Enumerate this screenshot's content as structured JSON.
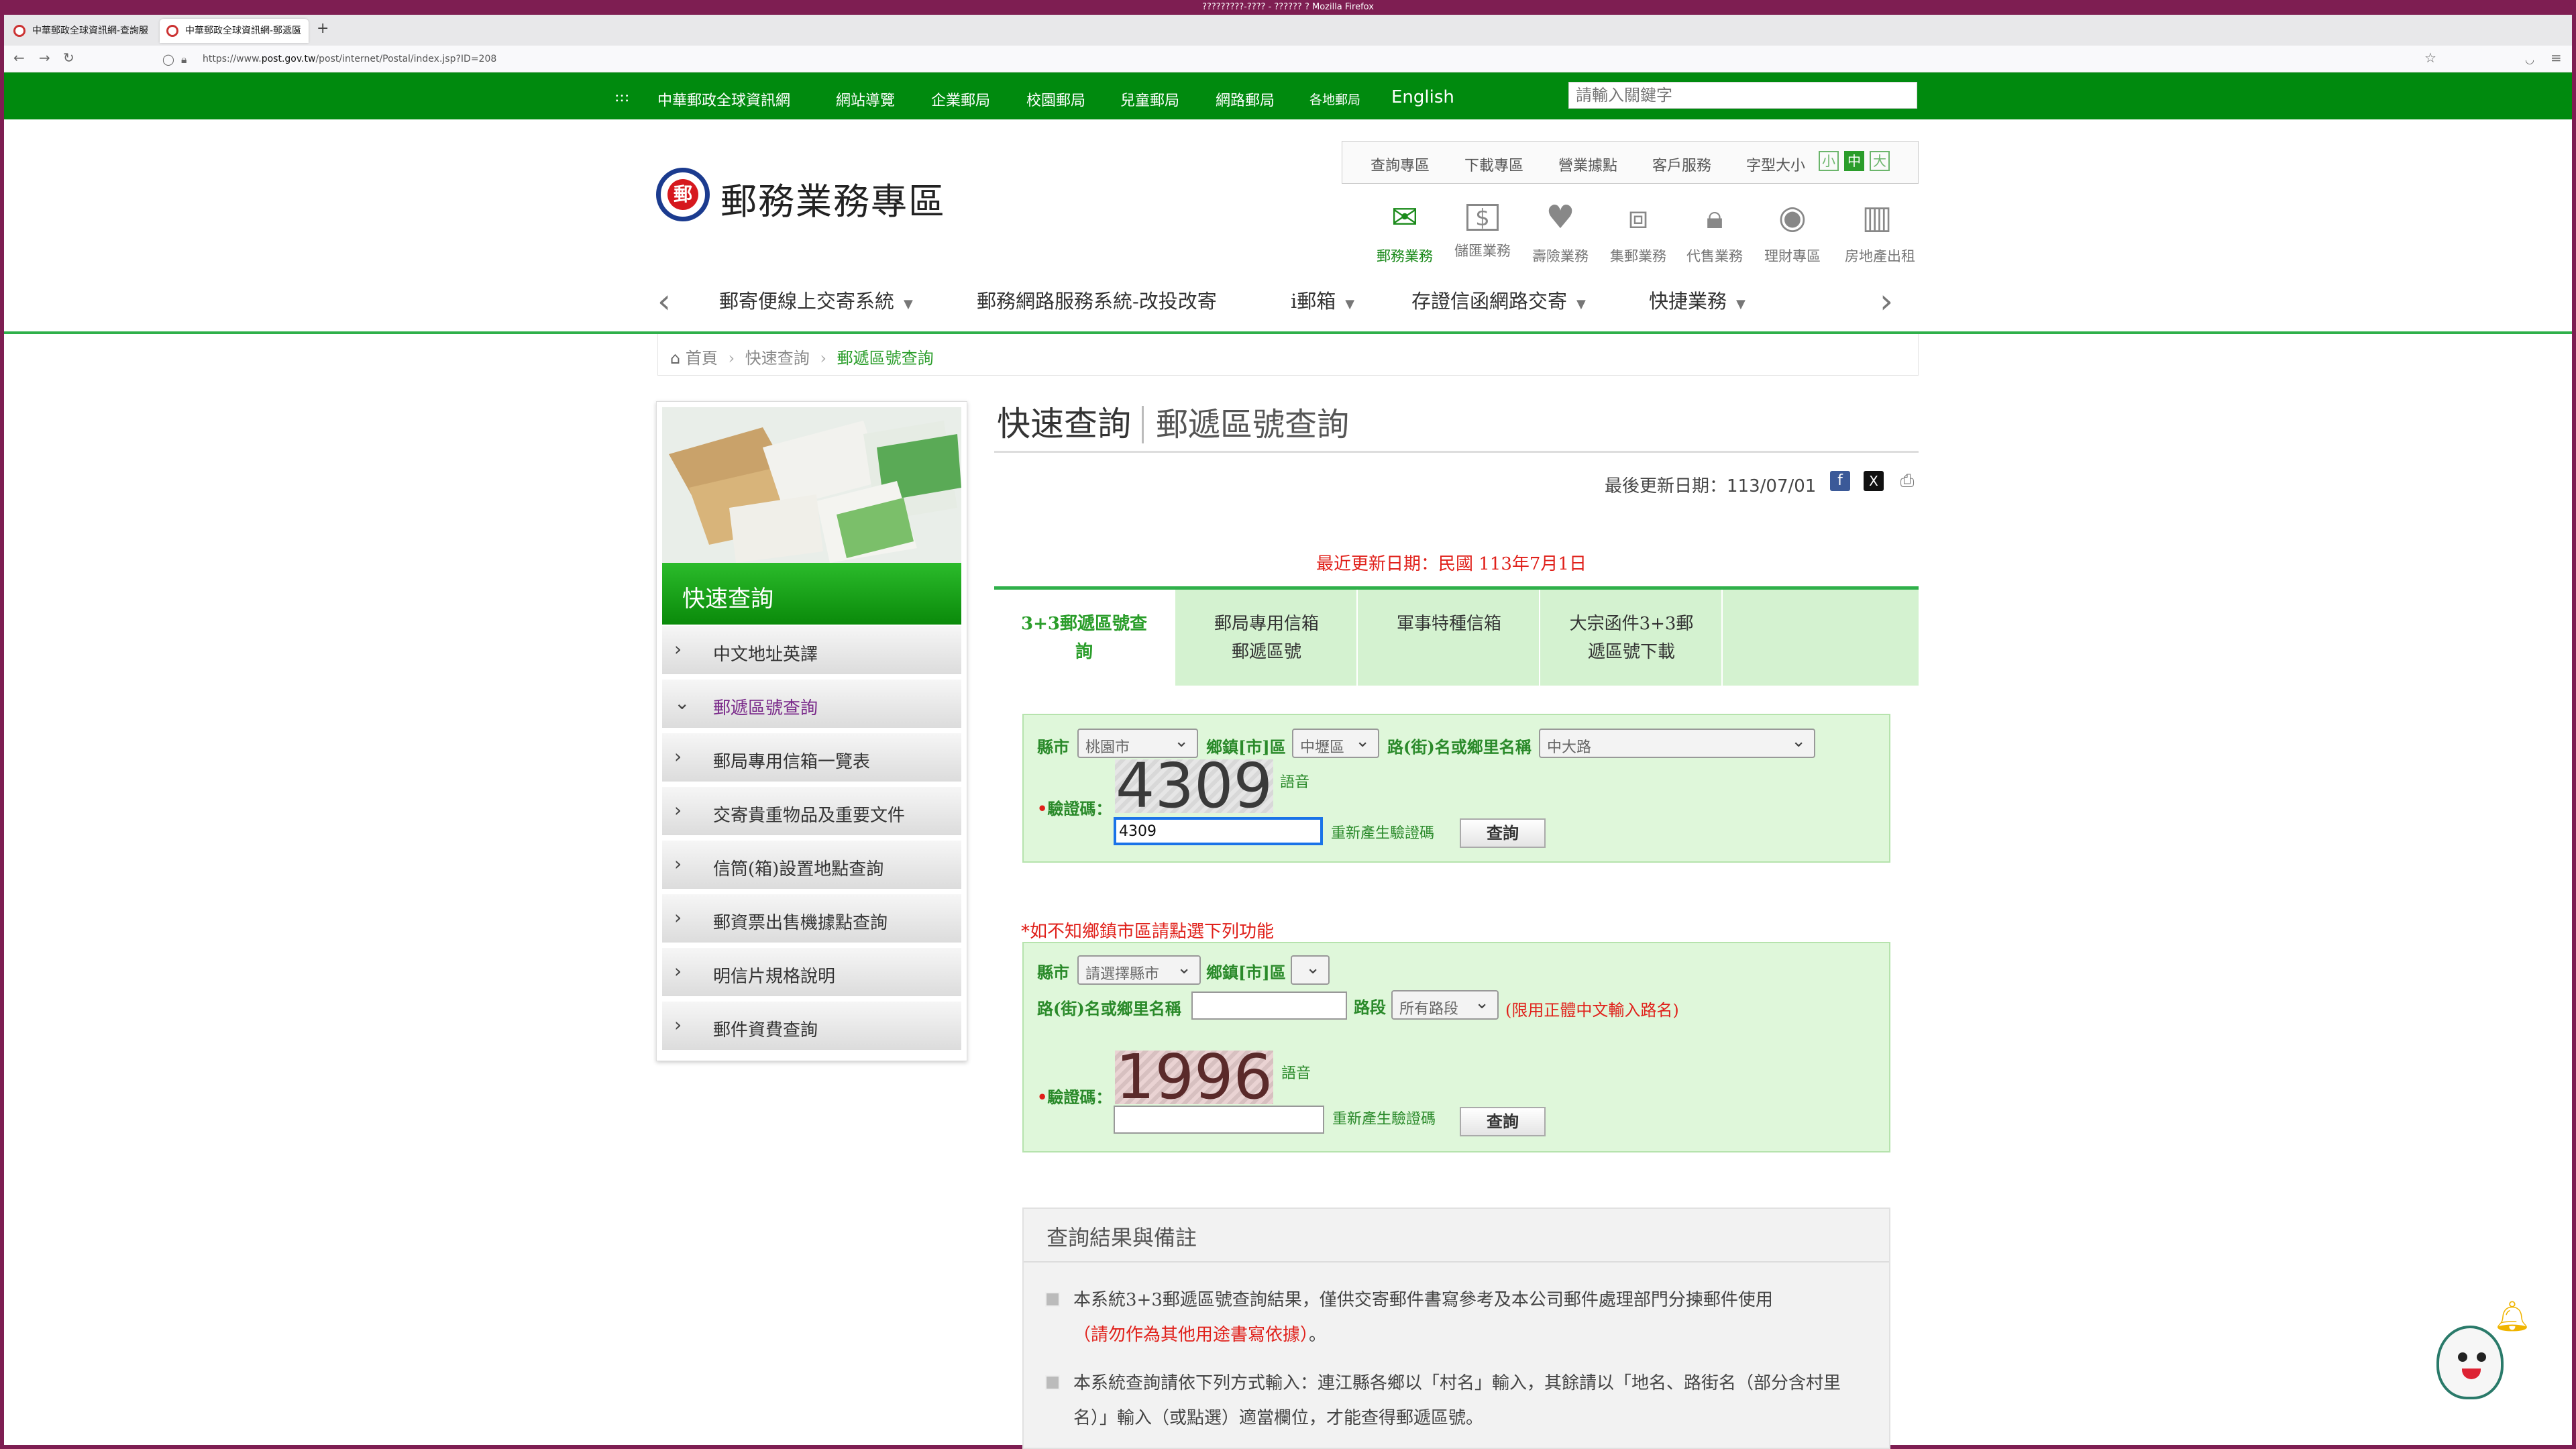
{
  "window": {
    "title": "?????????-???? - ?????? ? Mozilla Firefox"
  },
  "browser": {
    "tabs": [
      {
        "label": "中華郵政全球資訊網-查詢服"
      },
      {
        "label": "中華郵政全球資訊網-郵遞區"
      }
    ],
    "new_tab": "+",
    "url_prefix": "https://www.",
    "url_host": "post.gov.tw",
    "url_path": "/post/internet/Postal/index.jsp?ID=208"
  },
  "topnav": {
    "menu_icon": ":::",
    "items": [
      "中華郵政全球資訊網",
      "網站導覽",
      "企業郵局",
      "校園郵局",
      "兒童郵局",
      "網路郵局",
      "各地郵局",
      "English"
    ],
    "search_placeholder": "請輸入關鍵字"
  },
  "header": {
    "logo_mark": "郵",
    "logo_text": "郵務業務專區",
    "utility": [
      "查詢專區",
      "下載專區",
      "營業據點",
      "客戶服務",
      "字型大小"
    ],
    "font_sizes": [
      "小",
      "中",
      "大"
    ],
    "services": [
      {
        "icon": "mail-icon",
        "label": "郵務業務"
      },
      {
        "icon": "savings-icon",
        "label": "儲匯業務"
      },
      {
        "icon": "insurance-icon",
        "label": "壽險業務"
      },
      {
        "icon": "stamp-icon",
        "label": "集郵業務"
      },
      {
        "icon": "agency-icon",
        "label": "代售業務"
      },
      {
        "icon": "finance-icon",
        "label": "理財專區"
      },
      {
        "icon": "building-icon",
        "label": "房地產出租"
      }
    ],
    "menu": [
      "郵寄便線上交寄系統",
      "郵務網路服務系統-改投改寄",
      "i郵箱",
      "存證信函網路交寄",
      "快捷業務"
    ]
  },
  "breadcrumb": [
    "首頁",
    "快速查詢",
    "郵遞區號查詢"
  ],
  "sidebar": {
    "title": "快速查詢",
    "items": [
      "中文地址英譯",
      "郵遞區號查詢",
      "郵局專用信箱一覽表",
      "交寄貴重物品及重要文件",
      "信筒(箱)設置地點查詢",
      "郵資票出售機據點查詢",
      "明信片規格說明",
      "郵件資費查詢"
    ]
  },
  "main": {
    "title": "快速查詢",
    "subtitle": "郵遞區號查詢",
    "last_update_label": "最後更新日期：",
    "last_update": "113/07/01",
    "notice": "最近更新日期：民國 113年7月1日",
    "tabs": [
      [
        "3+3郵遞區號查",
        "詢"
      ],
      [
        "郵局專用信箱",
        "郵遞區號"
      ],
      [
        "軍事特種信箱",
        ""
      ],
      [
        "大宗函件3+3郵",
        "遞區號下載"
      ]
    ]
  },
  "form1": {
    "city_label": "縣市",
    "city_value": "桃園市",
    "district_label": "鄉鎮[市]區",
    "district_value": "中壢區",
    "road_label": "路(街)名或鄉里名稱",
    "road_value": "中大路",
    "audio": "語音",
    "captcha_label": "驗證碼：",
    "captcha_image": "4309",
    "captcha_input": "4309",
    "refresh": "重新產生驗證碼",
    "submit": "查詢"
  },
  "hint": "如不知鄉鎮市區請點選下列功能",
  "form2": {
    "city_label": "縣市",
    "city_value": "請選擇縣市",
    "district_label": "鄉鎮[市]區",
    "road_label": "路(街)名或鄉里名稱",
    "section_label": "路段",
    "section_value": "所有路段",
    "limit_note": "(限用正體中文輸入路名)",
    "audio": "語音",
    "captcha_label": "驗證碼：",
    "captcha_image": "1996",
    "refresh": "重新產生驗證碼",
    "submit": "查詢"
  },
  "results": {
    "title": "查詢結果與備註",
    "note1": "本系統3+3郵遞區號查詢結果，僅供交寄郵件書寫參考及本公司郵件處理部門分揀郵件使用",
    "note1_red": "（請勿作為其他用途書寫依據）",
    "note1_end": "。",
    "note2": "本系統查詢請依下列方式輸入：連江縣各鄉以「村名」輸入，其餘請以「地名、路街名（部分含村里名）」輸入（或點選）適當欄位，才能查得郵遞區號。"
  },
  "colors": {
    "brand_green": "#008a0e",
    "accent_red": "#e0201a",
    "tab_bg": "#d4f2d0"
  }
}
